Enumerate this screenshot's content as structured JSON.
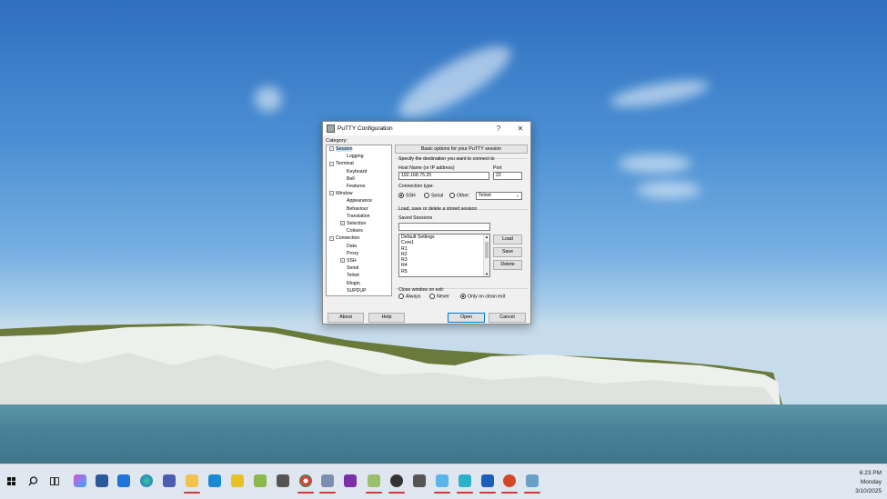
{
  "window": {
    "title": "PuTTY Configuration",
    "help_symbol": "?",
    "close_symbol": "✕"
  },
  "category": {
    "label": "Category:",
    "items": [
      {
        "label": "Session",
        "level": 0,
        "expander": "−",
        "selected": true
      },
      {
        "label": "Logging",
        "level": 1,
        "expander": ""
      },
      {
        "label": "Terminal",
        "level": 0,
        "expander": "−"
      },
      {
        "label": "Keyboard",
        "level": 1,
        "expander": ""
      },
      {
        "label": "Bell",
        "level": 1,
        "expander": ""
      },
      {
        "label": "Features",
        "level": 1,
        "expander": ""
      },
      {
        "label": "Window",
        "level": 0,
        "expander": "−"
      },
      {
        "label": "Appearance",
        "level": 1,
        "expander": ""
      },
      {
        "label": "Behaviour",
        "level": 1,
        "expander": ""
      },
      {
        "label": "Translation",
        "level": 1,
        "expander": ""
      },
      {
        "label": "Selection",
        "level": 1,
        "expander": "+"
      },
      {
        "label": "Colours",
        "level": 1,
        "expander": ""
      },
      {
        "label": "Connection",
        "level": 0,
        "expander": "−"
      },
      {
        "label": "Data",
        "level": 1,
        "expander": ""
      },
      {
        "label": "Proxy",
        "level": 1,
        "expander": ""
      },
      {
        "label": "SSH",
        "level": 1,
        "expander": "+"
      },
      {
        "label": "Serial",
        "level": 1,
        "expander": ""
      },
      {
        "label": "Telnet",
        "level": 1,
        "expander": ""
      },
      {
        "label": "Rlogin",
        "level": 1,
        "expander": ""
      },
      {
        "label": "SUPDUP",
        "level": 1,
        "expander": ""
      }
    ]
  },
  "session": {
    "header": "Basic options for your PuTTY session",
    "destination_label": "Specify the destination you want to connect to",
    "host_label": "Host Name (or IP address)",
    "host_value": "192.168.75.20",
    "port_label": "Port",
    "port_value": "22",
    "conn_type_label": "Connection type:",
    "conn_types": {
      "ssh": "SSH",
      "serial": "Serial",
      "other": "Other:"
    },
    "other_select": "Telnet",
    "load_save_label": "Load, save or delete a stored session",
    "saved_sessions_label": "Saved Sessions",
    "saved_sessions_value": "",
    "sessions": [
      "Default Settings",
      "Core1",
      "R1",
      "R2",
      "R3",
      "R4",
      "R5"
    ],
    "load_btn": "Load",
    "save_btn": "Save",
    "delete_btn": "Delete",
    "close_label": "Close window on exit:",
    "close_options": {
      "always": "Always",
      "never": "Never",
      "clean": "Only on clean exit"
    }
  },
  "buttons": {
    "about": "About",
    "help": "Help",
    "open": "Open",
    "cancel": "Cancel"
  },
  "taskbar": {
    "time": "6:23 PM",
    "day": "Monday",
    "date": "3/10/2025"
  }
}
